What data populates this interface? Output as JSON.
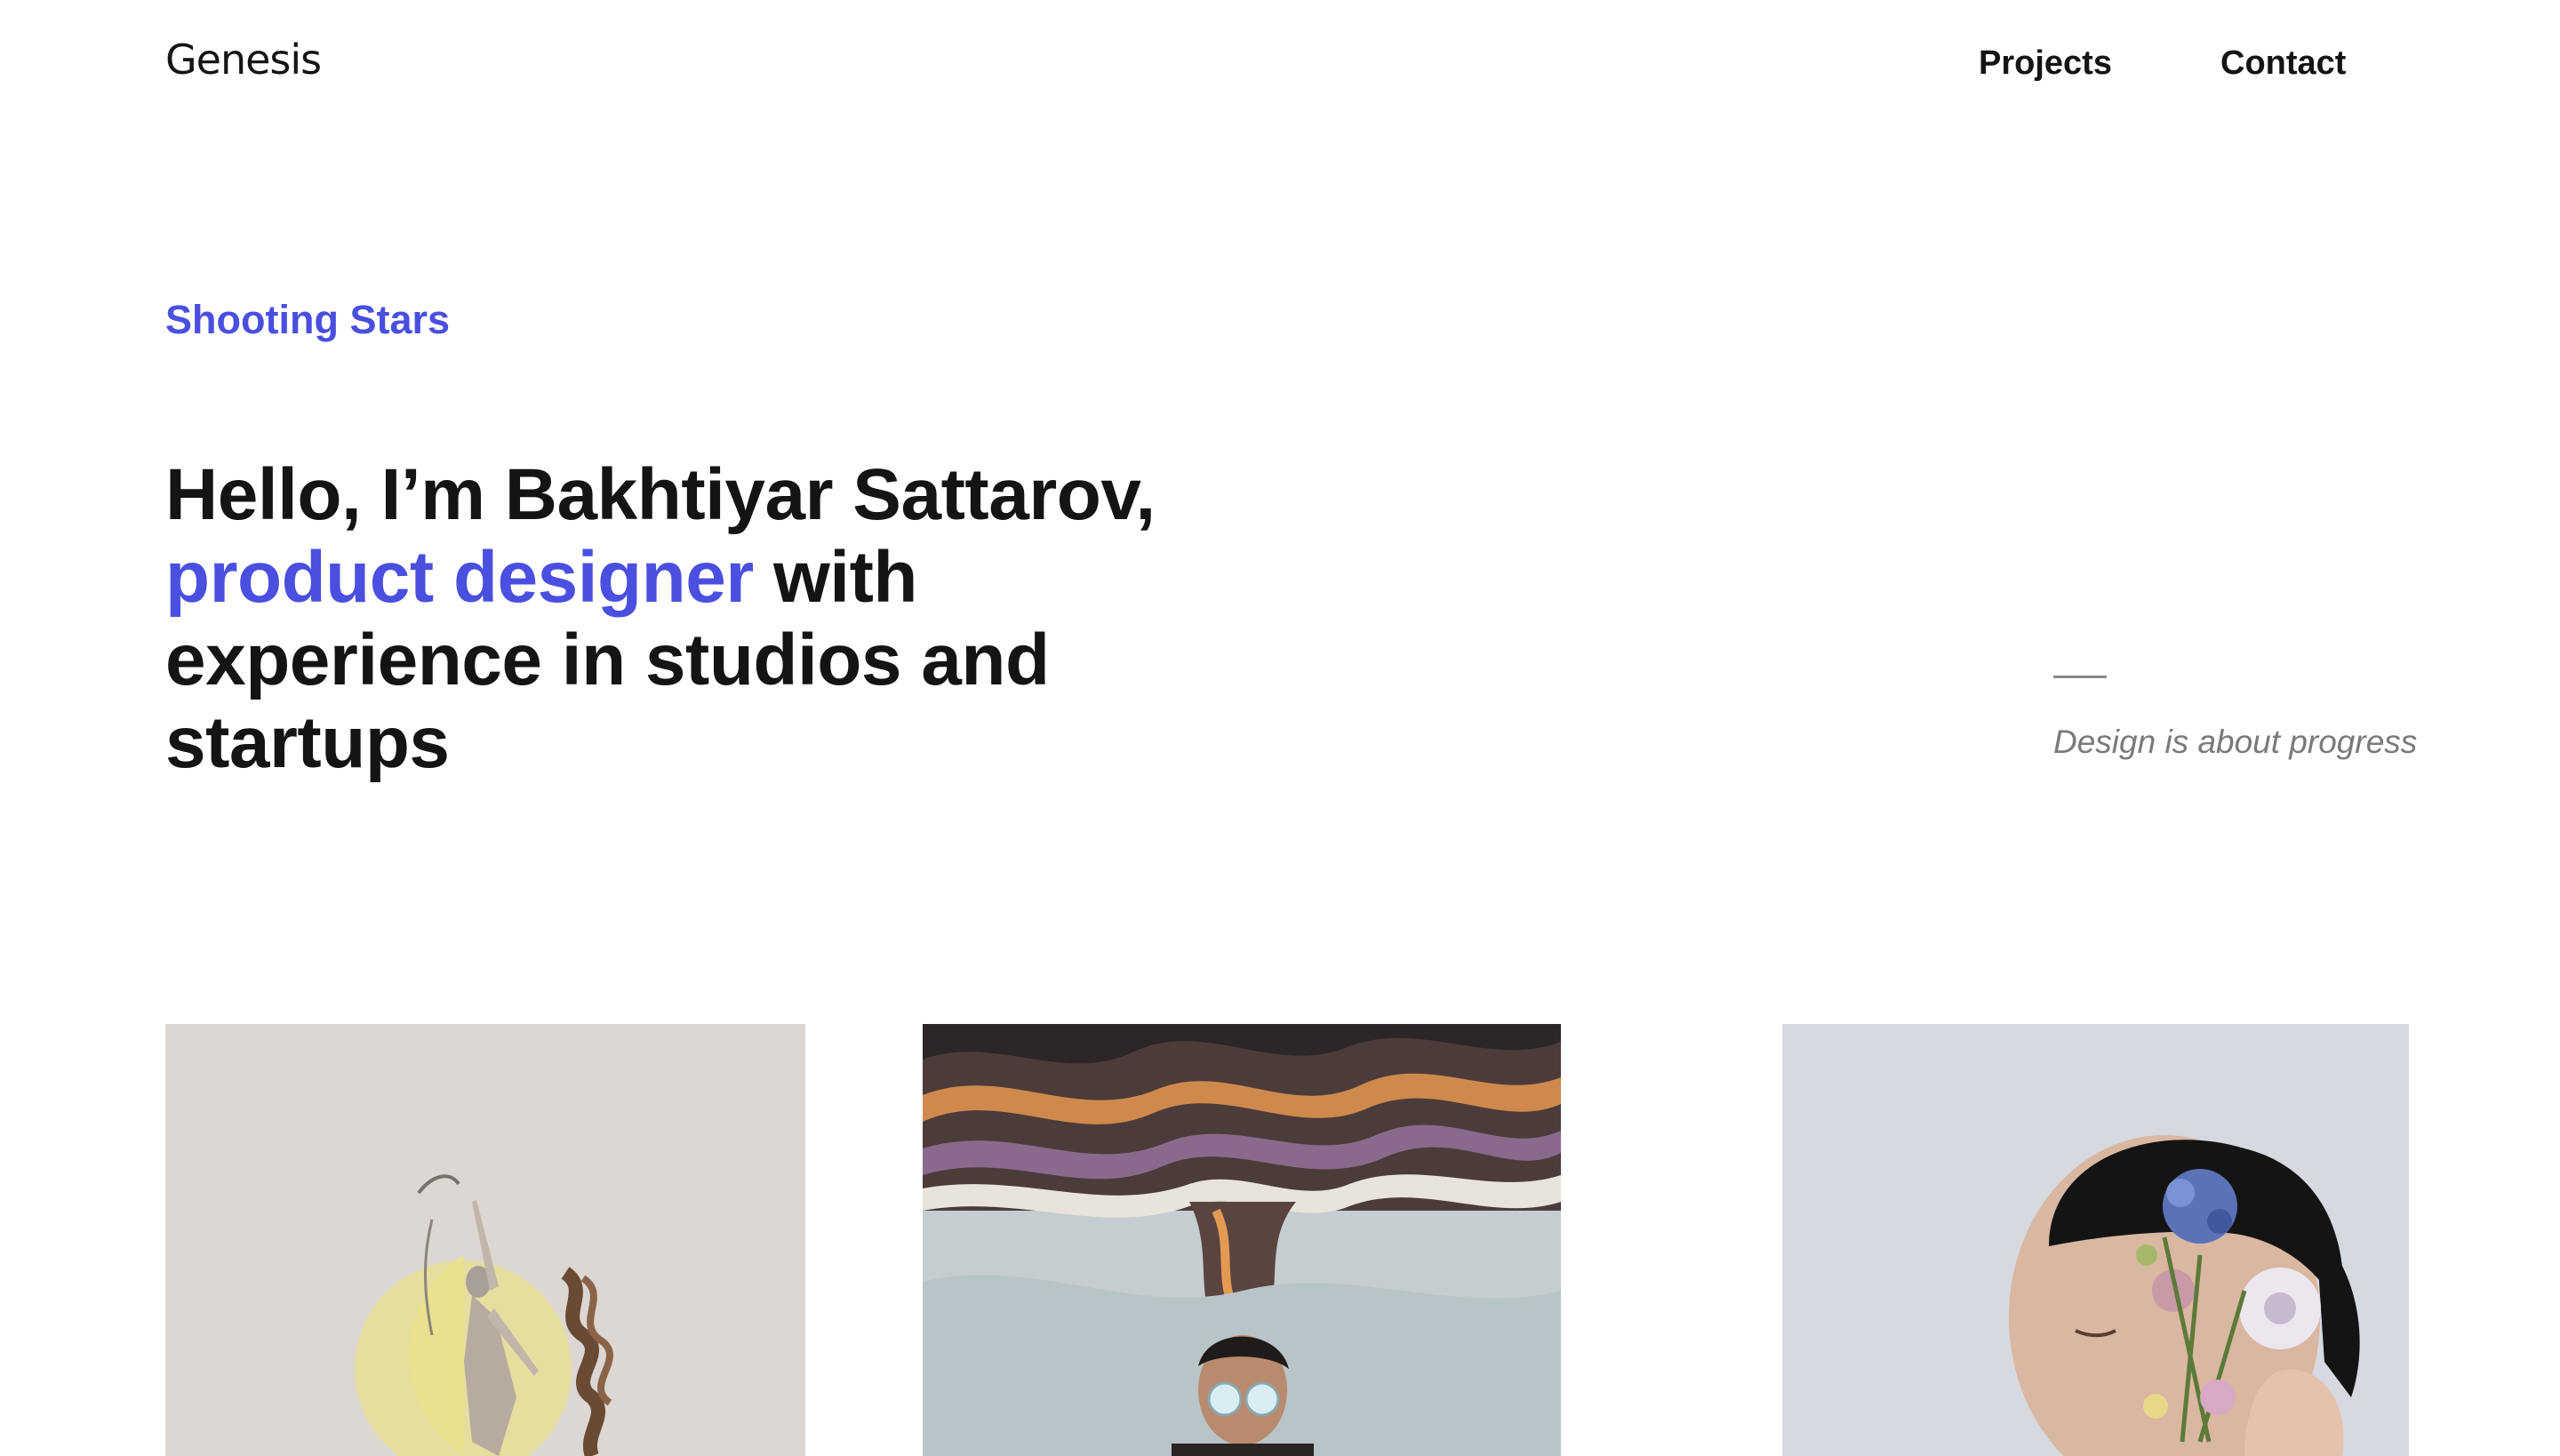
{
  "header": {
    "logo": "Genesis",
    "nav": [
      {
        "label": "Projects"
      },
      {
        "label": "Contact"
      }
    ]
  },
  "hero": {
    "eyebrow": "Shooting Stars",
    "headline": {
      "part1": "Hello, I’m Bakhtiyar Sattarov,",
      "accent": "product designer",
      "part2": " with experience in studios and startups"
    },
    "quote": "Design is about progress"
  },
  "colors": {
    "accent": "#4b4fe0",
    "text": "#141414",
    "muted": "#7a7a7a",
    "background": "#ffffff"
  },
  "projects": [
    {
      "image": "surreal-collage-woman-dancing"
    },
    {
      "image": "illustration-man-colorful-smoke"
    },
    {
      "image": "portrait-man-flowers-face"
    }
  ]
}
